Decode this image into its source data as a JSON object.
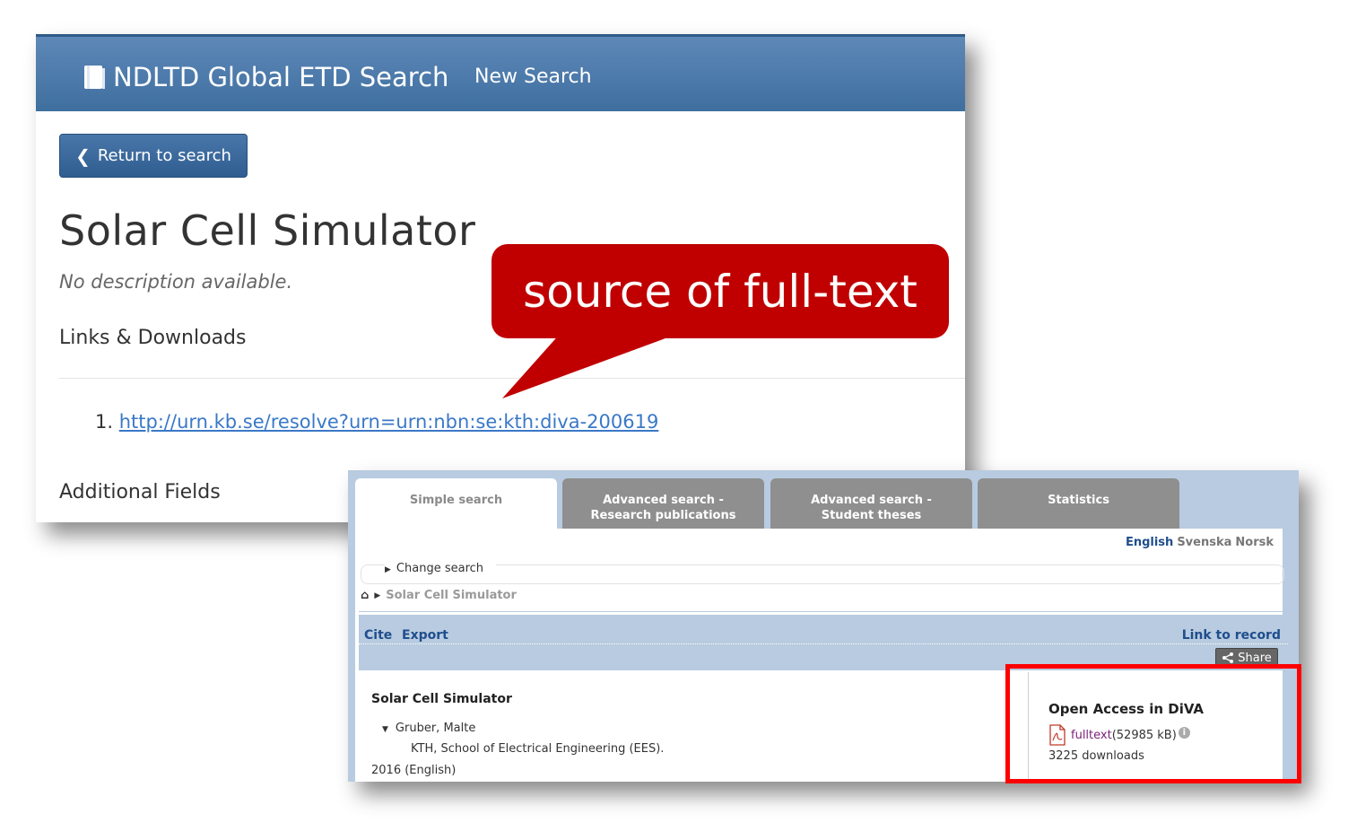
{
  "ndltd": {
    "brand": "NDLTD Global ETD Search",
    "new_search": "New Search",
    "return_button": "Return to search",
    "title": "Solar Cell Simulator",
    "description": "No description available.",
    "links_heading": "Links & Downloads",
    "link_number": "1.",
    "link_url": "http://urn.kb.se/resolve?urn=urn:nbn:se:kth:diva-200619",
    "additional_fields": "Additional Fields",
    "colors": {
      "navbar": "#4a78a8",
      "link": "#3a78c8"
    }
  },
  "callout": {
    "text": "source of full-text",
    "color": "#c00000"
  },
  "diva": {
    "tabs": [
      {
        "label": "Simple search",
        "active": true
      },
      {
        "label": "Advanced search - Research publications",
        "active": false
      },
      {
        "label": "Advanced search - Student theses",
        "active": false
      },
      {
        "label": "Statistics",
        "active": false
      }
    ],
    "languages": {
      "english": "English",
      "swedish": "Svenska",
      "norwegian": "Norsk"
    },
    "change_search": "Change search",
    "breadcrumb": "Solar Cell Simulator",
    "toolbar": {
      "cite": "Cite",
      "export": "Export",
      "link_to_record": "Link to record",
      "share": "Share"
    },
    "record": {
      "title": "Solar Cell Simulator",
      "author": "Gruber, Malte",
      "affiliation": "KTH, School of Electrical Engineering (EES).",
      "year": "2016 (English)"
    },
    "open_access": {
      "title": "Open Access in DiVA",
      "fulltext_link": "fulltext",
      "size": "(52985 kB)",
      "downloads": "3225 downloads"
    }
  },
  "highlight": {
    "color": "#ff0000"
  }
}
